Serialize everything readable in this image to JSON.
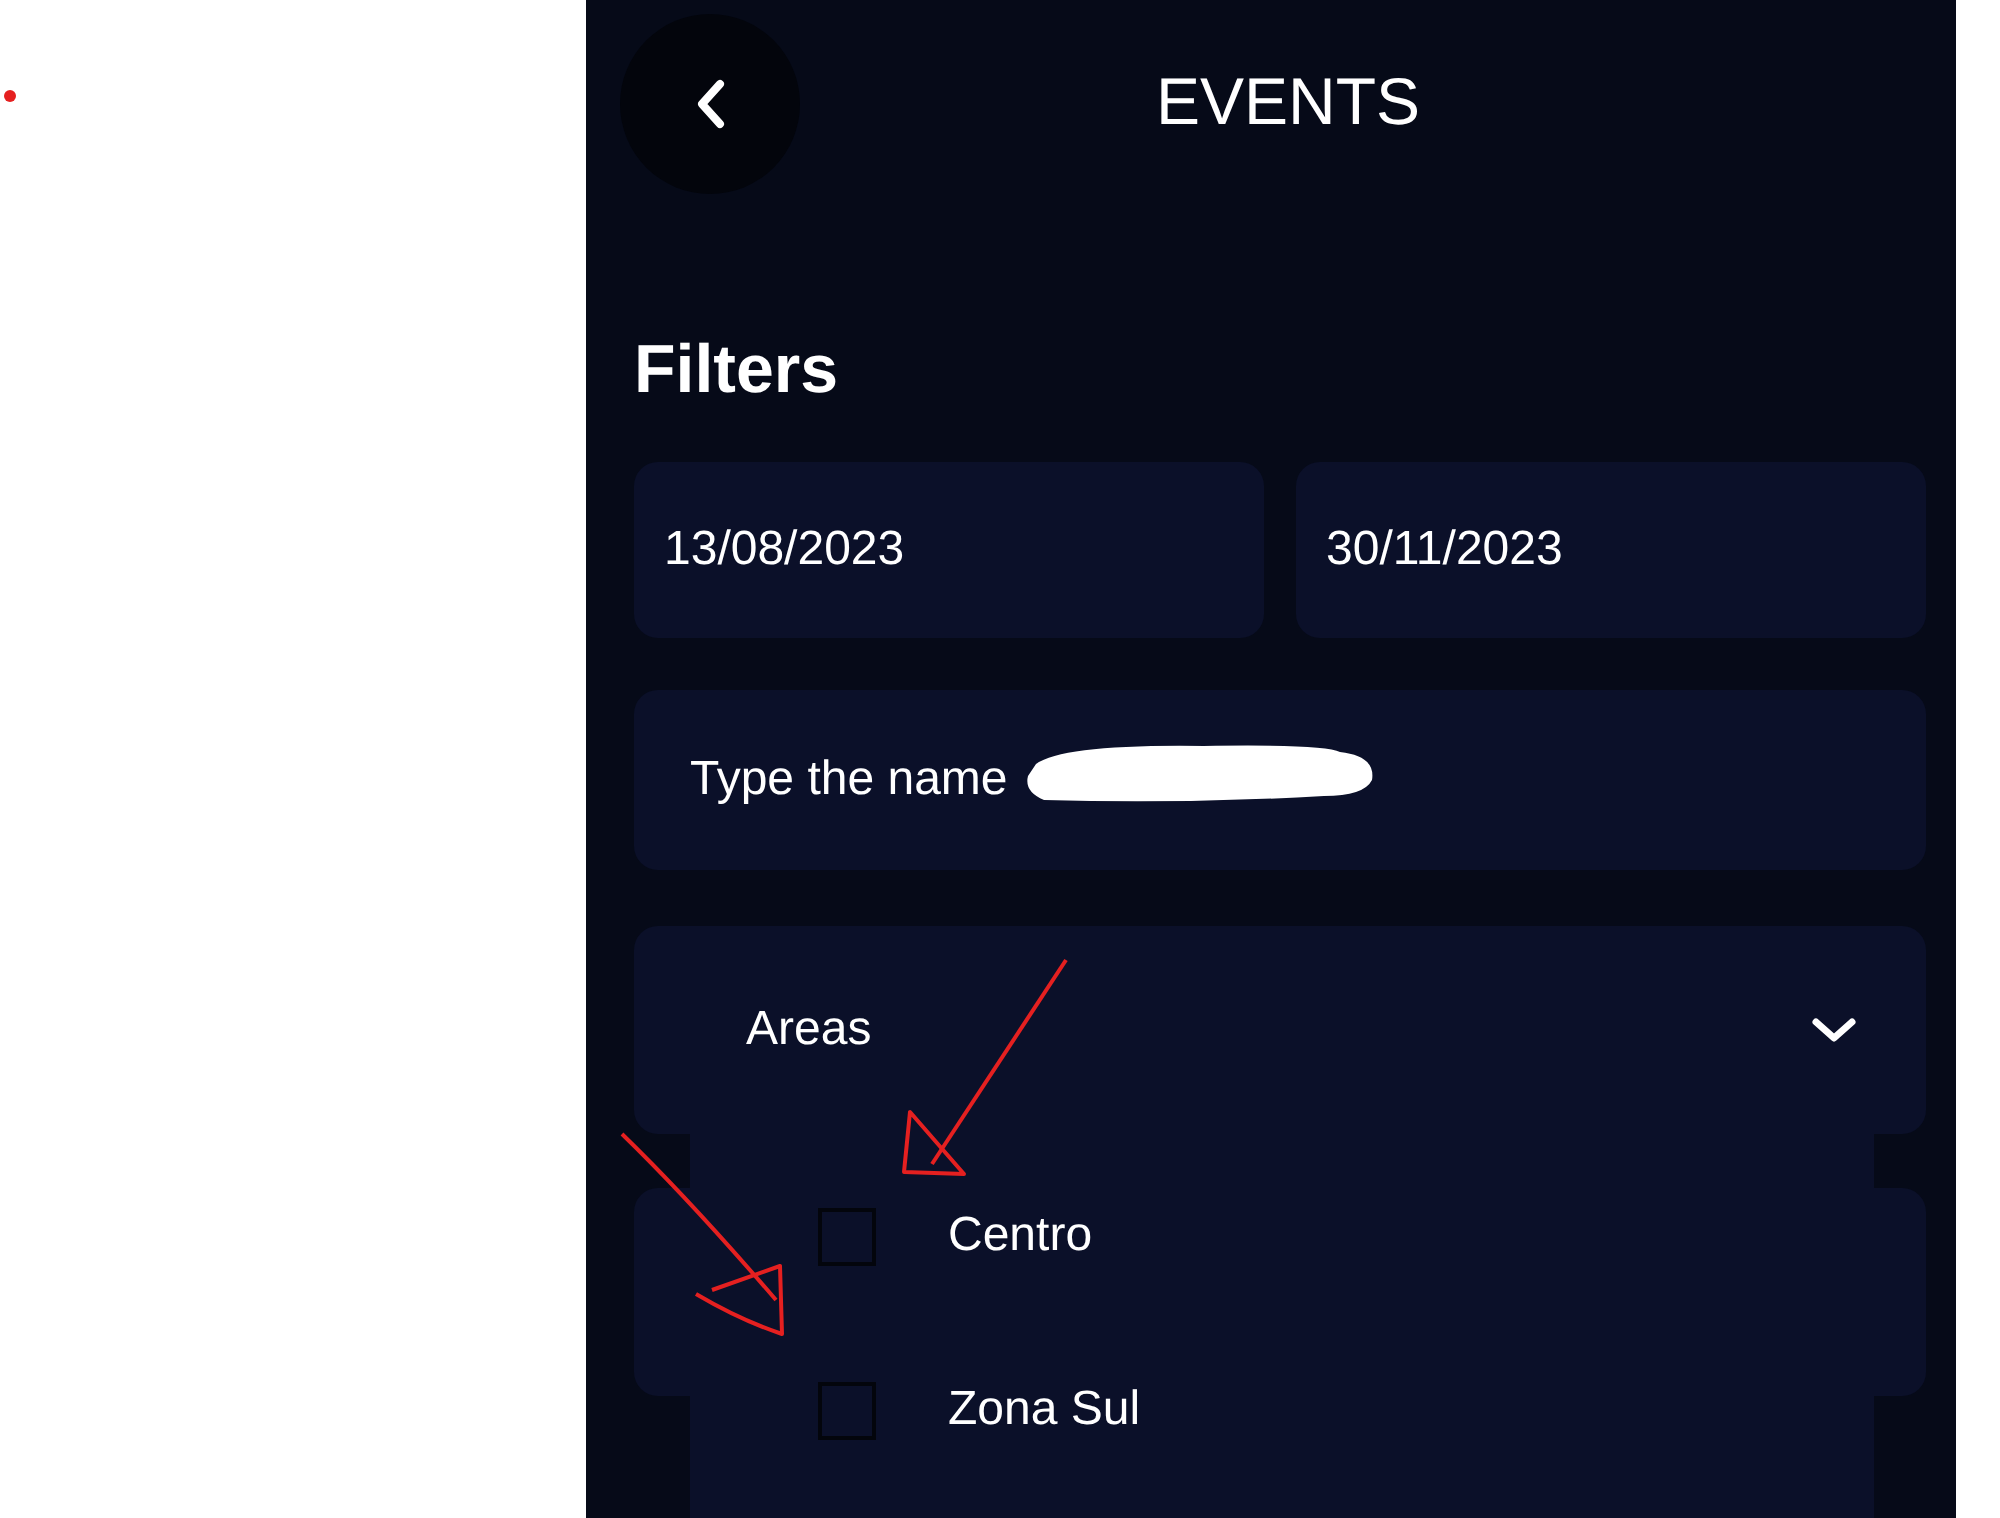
{
  "header": {
    "title": "EVENTS"
  },
  "filters": {
    "heading": "Filters",
    "dates": [
      "13/08/2023",
      "30/11/2023"
    ],
    "name_field": {
      "value": "Type the name"
    },
    "areas": {
      "label": "Areas",
      "expanded": true,
      "options": [
        {
          "label": "Centro",
          "checked": false
        },
        {
          "label": "Zona Sul",
          "checked": false
        }
      ]
    }
  }
}
